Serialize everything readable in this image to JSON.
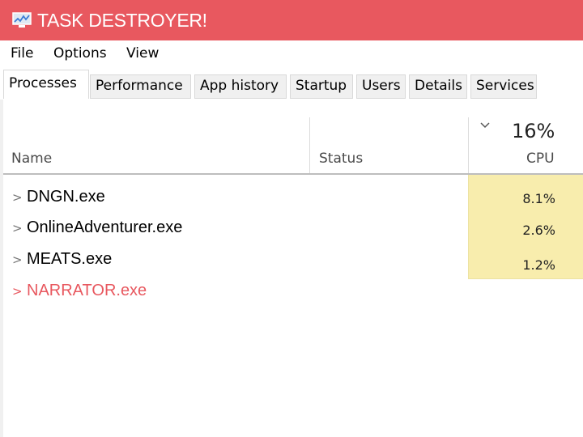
{
  "app": {
    "title": "TASK DESTROYER!",
    "accent_color": "#e8585f",
    "icon": "monitor-chart-icon"
  },
  "menu": [
    "File",
    "Options",
    "View"
  ],
  "tabs": [
    "Processes",
    "Performance",
    "App history",
    "Startup",
    "Users",
    "Details",
    "Services"
  ],
  "active_tab": "Processes",
  "columns": {
    "name": "Name",
    "status": "Status",
    "cpu": {
      "total": "16%",
      "label": "CPU",
      "sorted": "descending",
      "highlight_color": "#f8edad"
    }
  },
  "processes": [
    {
      "name": "DNGN.exe",
      "status": "",
      "cpu": "8.1%"
    },
    {
      "name": "OnlineAdventurer.exe",
      "status": "",
      "cpu": "2.6%"
    },
    {
      "name": "MEATS.exe",
      "status": "",
      "cpu": "1.2%"
    },
    {
      "name": "NARRATOR.exe",
      "status": "",
      "cpu": "",
      "highlighted": true
    }
  ]
}
